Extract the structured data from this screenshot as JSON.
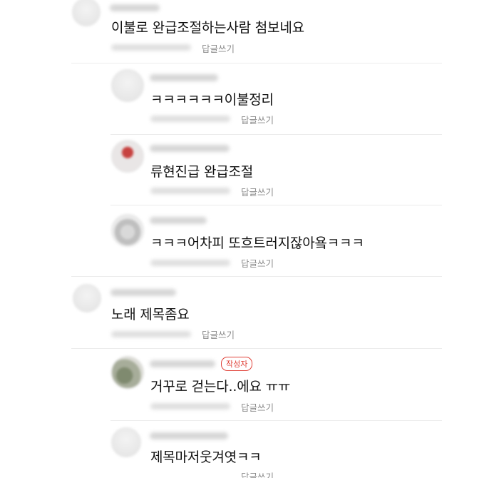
{
  "comments": [
    {
      "text": "이불로 완급조절하는사람 첨보네요",
      "reply_label": "답글쓰기"
    },
    {
      "text": "ㅋㅋㅋㅋㅋㅋ이불정리",
      "reply_label": "답글쓰기"
    },
    {
      "text": "류현진급 완급조절",
      "reply_label": "답글쓰기"
    },
    {
      "text": "ㅋㅋㅋ어차피 또흐트러지잖아욬ㅋㅋㅋ",
      "reply_label": "답글쓰기"
    },
    {
      "text": "노래 제목좀요",
      "reply_label": "답글쓰기"
    },
    {
      "text": "거꾸로 걷는다..에요 ㅠㅠ",
      "reply_label": "답글쓰기",
      "badge": "작성자"
    },
    {
      "text": "제목마저웃겨엿ㅋㅋ",
      "reply_label": "답글쓰기"
    }
  ]
}
